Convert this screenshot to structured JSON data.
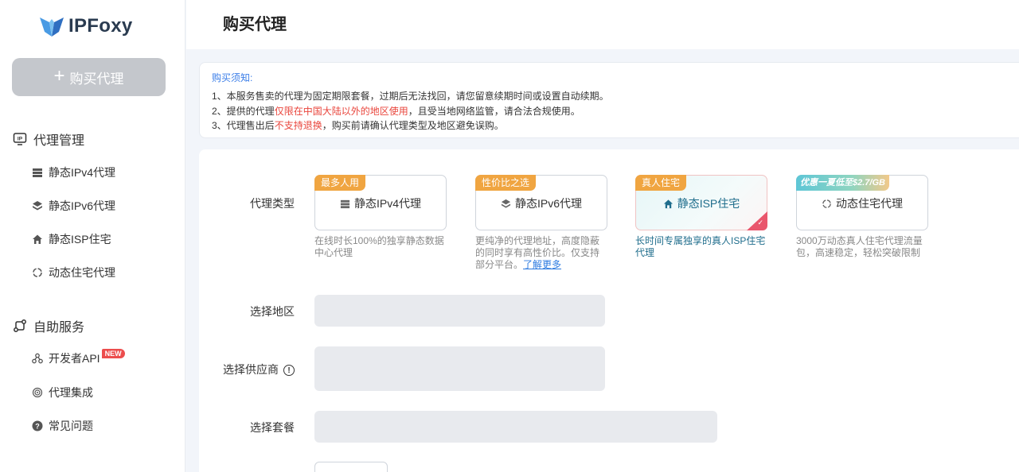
{
  "app": {
    "logo_text": "IPFoxy"
  },
  "sidebar": {
    "buy_button": {
      "icon": "plus-icon",
      "label": "购买代理"
    },
    "groups": [
      {
        "title": "代理管理",
        "icon": "ip-monitor-icon",
        "items": [
          {
            "label": "静态IPv4代理",
            "icon": "server-stack-icon"
          },
          {
            "label": "静态IPv6代理",
            "icon": "layers-icon"
          },
          {
            "label": "静态ISP住宅",
            "icon": "house-icon"
          },
          {
            "label": "动态住宅代理",
            "icon": "refresh-cycle-icon"
          }
        ]
      },
      {
        "title": "自助服务",
        "icon": "flow-icon",
        "items": [
          {
            "label": "开发者API",
            "icon": "api-nodes-icon",
            "badge": "NEW"
          },
          {
            "label": "代理集成",
            "icon": "integration-icon"
          },
          {
            "label": "常见问题",
            "icon": "question-icon"
          }
        ]
      }
    ]
  },
  "header": {
    "title": "购买代理"
  },
  "notice": {
    "title": "购买须知:",
    "line1": "1、本服务售卖的代理为固定期限套餐，过期后无法找回，请您留意续期时间或设置自动续期。",
    "line2_a": "2、提供的代理",
    "line2_red": "仅限在中国大陆以外的地区使用",
    "line2_b": "，且受当地网络监管，请合法合规使用。",
    "line3_a": "3、代理售出后",
    "line3_red": "不支持退换",
    "line3_b": "，购买前请确认代理类型及地区避免误购。"
  },
  "form": {
    "type_label": "代理类型",
    "region_label": "选择地区",
    "provider_label": "选择供应商",
    "plan_label": "选择套餐",
    "types": [
      {
        "tag": "最多人用",
        "tag_color": "#f0a541",
        "name": "静态IPv4代理",
        "icon": "server-stack-icon",
        "desc": "在线时长100%的独享静态数据中心代理"
      },
      {
        "tag": "性价比之选",
        "tag_color": "#f0a541",
        "name": "静态IPv6代理",
        "icon": "layers-icon",
        "desc": "更纯净的代理地址，高度隐蔽的同时享有高性价比。仅支持部分平台。",
        "link": "了解更多"
      },
      {
        "tag": "真人住宅",
        "tag_color": "#f0a541",
        "name": "静态ISP住宅",
        "icon": "house-icon",
        "desc": "长时间专属独享的真人ISP住宅代理",
        "selected": true
      },
      {
        "tag": "优惠一夏低至$2.7/GB",
        "tag_color": "#5ec6d6",
        "name": "动态住宅代理",
        "icon": "refresh-cycle-icon",
        "desc": "3000万动态真人住宅代理流量包，高速稳定，轻松突破限制"
      }
    ]
  },
  "colors": {
    "accent": "#3b7ee8",
    "warning": "#e9453c",
    "selected_text": "#1f6d8c",
    "tick": "#e9566c"
  }
}
